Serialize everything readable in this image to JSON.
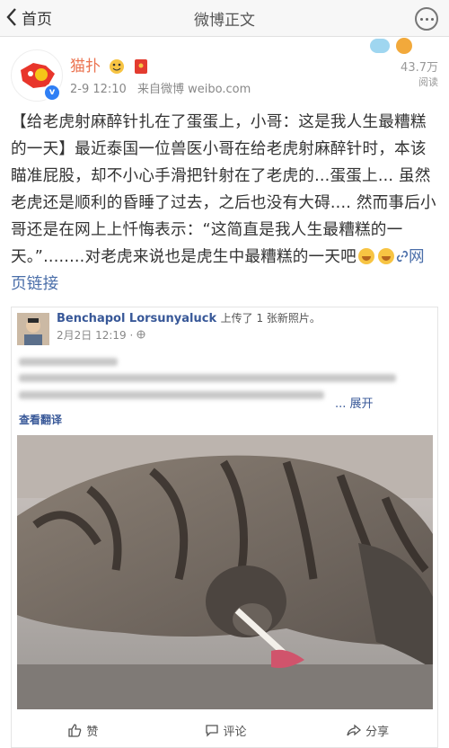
{
  "nav": {
    "back_label": "首页",
    "title": "微博正文"
  },
  "post": {
    "username": "猫扑",
    "time": "2-9 12:10",
    "source": "来自微博 weibo.com",
    "read_count": "43.7万",
    "read_label": "阅读",
    "text": "【给老虎射麻醉针扎在了蛋蛋上，小哥：这是我人生最糟糕的一天】最近泰国一位兽医小哥在给老虎射麻醉针时，本该瞄准屁股，却不小心手滑把针射在了老虎的...蛋蛋上... 虽然老虎还是顺利的昏睡了过去，之后也没有大碍.... 然而事后小哥还是在网上上忏悔表示：“这简直是我人生最糟糕的一天。”........对老虎来说也是虎生中最糟糕的一天吧",
    "link_label": "网页链接"
  },
  "embed": {
    "author": "Benchapol Lorsunyaluck",
    "action": "上传了 1 张新照片。",
    "time": "2月2日 12:19 · ",
    "expand_label": "... 展开",
    "translate_label": "查看翻译",
    "actions": {
      "like": "赞",
      "comment": "评论",
      "share": "分享"
    }
  },
  "colors": {
    "username": "#eb7350",
    "link": "#4a6ea9",
    "fb_blue": "#385898",
    "verified": "#2f7ff5"
  }
}
